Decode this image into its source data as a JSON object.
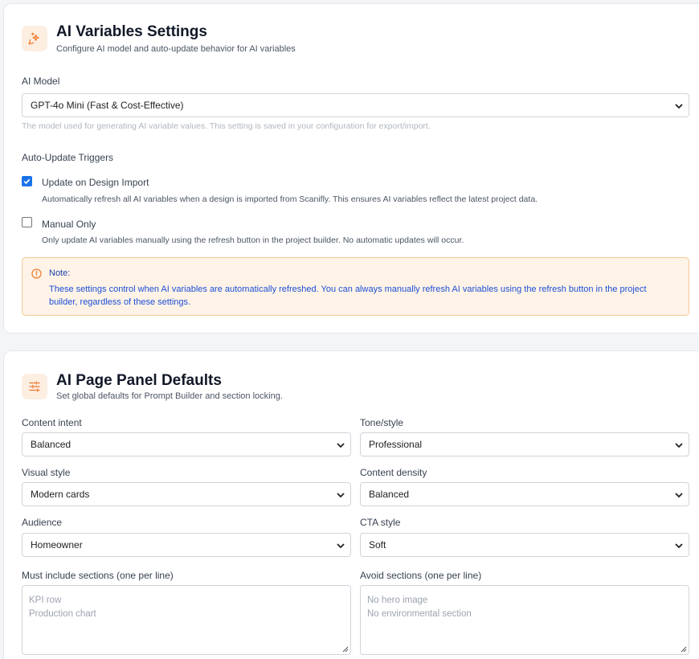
{
  "ai_variables": {
    "title": "AI Variables Settings",
    "subtitle": "Configure AI model and auto-update behavior for AI variables",
    "icon": "sparkles-icon",
    "model_label": "AI Model",
    "model_value": "GPT-4o Mini (Fast & Cost-Effective)",
    "model_help": "The model used for generating AI variable values. This setting is saved in your configuration for export/import.",
    "triggers_label": "Auto-Update Triggers",
    "triggers": [
      {
        "label": "Update on Design Import",
        "checked": true,
        "description": "Automatically refresh all AI variables when a design is imported from Scanifly. This ensures AI variables reflect the latest project data."
      },
      {
        "label": "Manual Only",
        "checked": false,
        "description": "Only update AI variables manually using the refresh button in the project builder. No automatic updates will occur."
      }
    ],
    "note": {
      "title": "Note:",
      "body": "These settings control when AI variables are automatically refreshed. You can always manually refresh AI variables using the refresh button in the project builder, regardless of these settings."
    }
  },
  "page_panel": {
    "title": "AI Page Panel Defaults",
    "subtitle": "Set global defaults for Prompt Builder and section locking.",
    "icon": "sliders-icon",
    "fields": {
      "content_intent": {
        "label": "Content intent",
        "value": "Balanced"
      },
      "tone_style": {
        "label": "Tone/style",
        "value": "Professional"
      },
      "visual_style": {
        "label": "Visual style",
        "value": "Modern cards"
      },
      "content_density": {
        "label": "Content density",
        "value": "Balanced"
      },
      "audience": {
        "label": "Audience",
        "value": "Homeowner"
      },
      "cta_style": {
        "label": "CTA style",
        "value": "Soft"
      }
    },
    "must_include": {
      "label": "Must include sections (one per line)",
      "placeholder_lines": [
        "KPI row",
        "Production chart"
      ]
    },
    "avoid": {
      "label": "Avoid sections (one per line)",
      "placeholder_lines": [
        "No hero image",
        "No environmental section"
      ]
    }
  },
  "colors": {
    "accent_orange": "#f07a2e",
    "checkbox_blue": "#1a73e8",
    "note_background": "#fef3e6",
    "note_text": "#1d4ed8"
  }
}
